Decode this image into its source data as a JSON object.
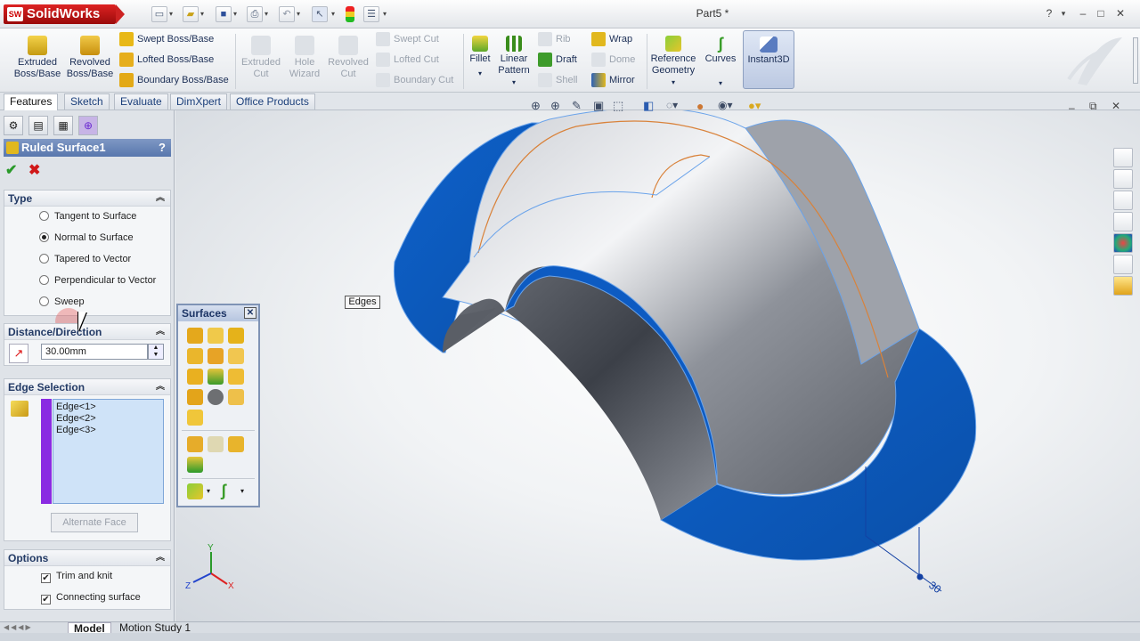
{
  "titlebar": {
    "app_name": "SolidWorks",
    "document": "Part5 *",
    "logo_mark": "SW"
  },
  "command_manager": {
    "buttons": [
      {
        "label1": "Extruded",
        "label2": "Boss/Base"
      },
      {
        "label1": "Revolved",
        "label2": "Boss/Base"
      },
      {
        "label1": "Extruded",
        "label2": "Cut"
      },
      {
        "label1": "Hole",
        "label2": "Wizard"
      },
      {
        "label1": "Revolved",
        "label2": "Cut"
      },
      {
        "label1": "Fillet",
        "label2": ""
      },
      {
        "label1": "Linear",
        "label2": "Pattern"
      },
      {
        "label1": "Reference",
        "label2": "Geometry"
      },
      {
        "label1": "Curves",
        "label2": ""
      },
      {
        "label1": "Instant3D",
        "label2": ""
      }
    ],
    "small": [
      "Swept Boss/Base",
      "Lofted Boss/Base",
      "Boundary Boss/Base",
      "Swept Cut",
      "Lofted Cut",
      "Boundary Cut",
      "Rib",
      "Draft",
      "Shell",
      "Wrap",
      "Dome",
      "Mirror"
    ]
  },
  "tabs": [
    "Features",
    "Sketch",
    "Evaluate",
    "DimXpert",
    "Office Products"
  ],
  "property_manager": {
    "title": "Ruled Surface1",
    "help": "?",
    "type": {
      "heading": "Type",
      "options": [
        "Tangent to Surface",
        "Normal to Surface",
        "Tapered to Vector",
        "Perpendicular to Vector",
        "Sweep"
      ],
      "selected": 1
    },
    "distance": {
      "heading": "Distance/Direction",
      "value": "30.00mm"
    },
    "edge_selection": {
      "heading": "Edge Selection",
      "items": [
        "Edge<1>",
        "Edge<2>",
        "Edge<3>"
      ],
      "button": "Alternate Face"
    },
    "options": {
      "heading": "Options",
      "items": [
        {
          "label": "Trim and knit",
          "checked": true
        },
        {
          "label": "Connecting surface",
          "checked": true
        }
      ]
    }
  },
  "surfaces_toolbar": {
    "title": "Surfaces"
  },
  "viewport": {
    "tooltip": "Edges",
    "dimension": "30",
    "triad": {
      "x": "X",
      "y": "Y",
      "z": "Z"
    }
  },
  "bottom_tabs": [
    "Model",
    "Motion Study 1"
  ],
  "colors": {
    "accent": "#5877ad",
    "surface_blue": "#0a5bc4",
    "body_gray": "#8b8f97",
    "edge_orange": "#d9823a"
  }
}
